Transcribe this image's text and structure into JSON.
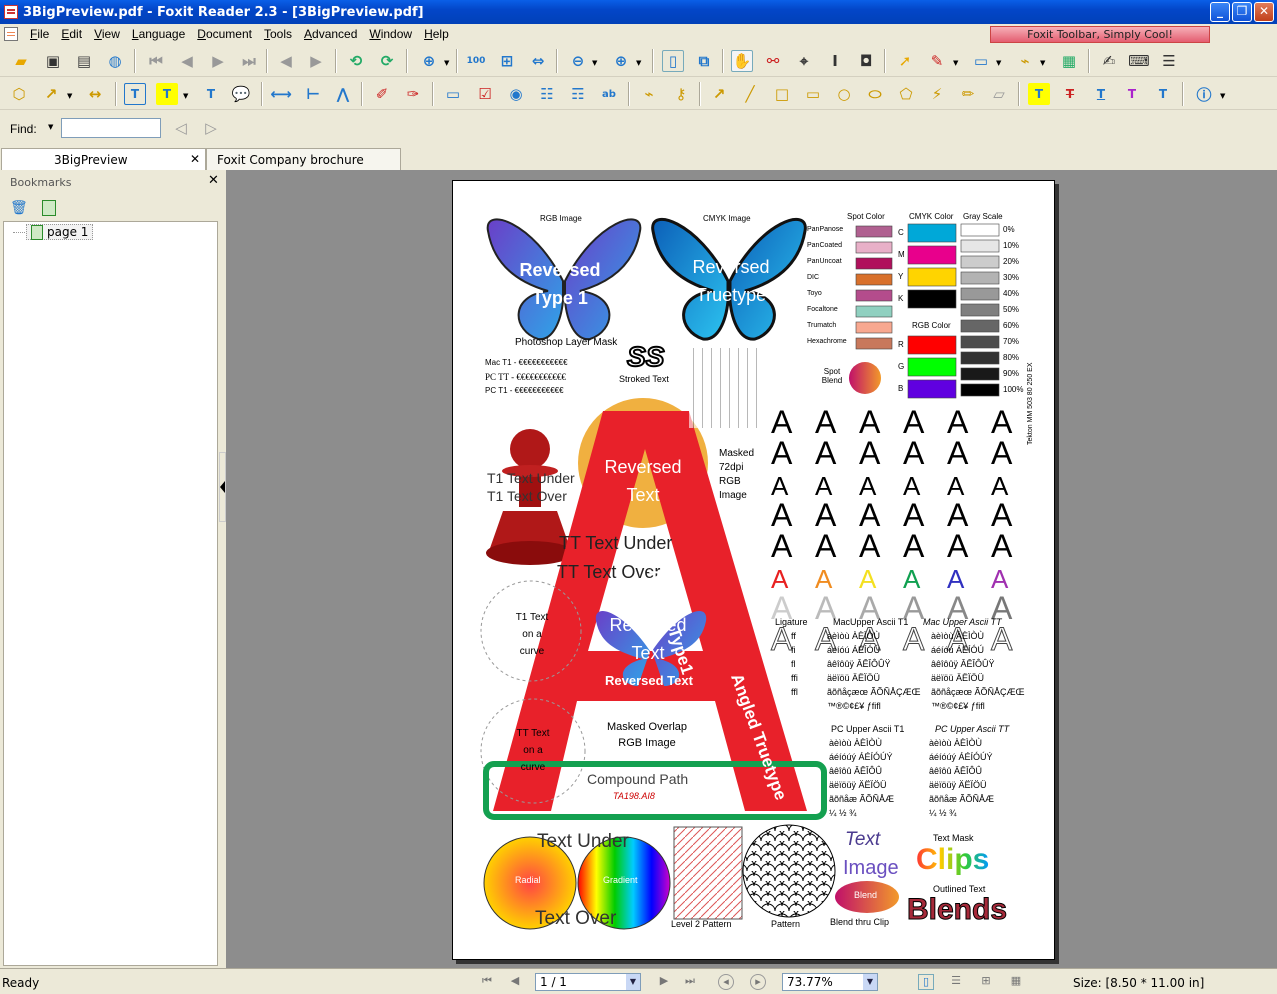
{
  "window": {
    "title": "3BigPreview.pdf - Foxit Reader 2.3 - [3BigPreview.pdf]"
  },
  "menu": [
    "File",
    "Edit",
    "View",
    "Language",
    "Document",
    "Tools",
    "Advanced",
    "Window",
    "Help"
  ],
  "promo": "Foxit Toolbar, Simply Cool!",
  "find": {
    "label": "Find:",
    "value": ""
  },
  "tabs": [
    {
      "label": "3BigPreview"
    },
    {
      "label": "Foxit Company brochure"
    }
  ],
  "sidebar": {
    "title": "Bookmarks",
    "bookmark": "page 1"
  },
  "status": {
    "ready": "Ready",
    "page": "1 / 1",
    "zoom": "73.77%",
    "size": "Size: [8.50 * 11.00 in]"
  },
  "pdf": {
    "rgb_image": "RGB Image",
    "cmyk_image": "CMYK Image",
    "rev_type1": "Reversed Type 1",
    "rev_truetype": "Reversed Truetype",
    "ps_mask": "Photoshop Layer Mask",
    "spot_color": "Spot Color",
    "cmyk_color": "CMYK Color",
    "gray_scale": "Gray Scale",
    "rgb_color": "RGB Color",
    "spot_names": [
      "PanPanose",
      "PanCoated",
      "PanUncoat",
      "DIC",
      "Toyo",
      "Focaltone",
      "Trumatch",
      "Hexachrome"
    ],
    "spot_colors": [
      "#b06090",
      "#e8b0c8",
      "#b0105c",
      "#d8702c",
      "#b44c8c",
      "#90d0c0",
      "#f8a890",
      "#c8785c"
    ],
    "cmyk_labels": [
      "C",
      "M",
      "Y",
      "K"
    ],
    "cmyk_colors": [
      "#00a8d8",
      "#e8008c",
      "#ffd400",
      "#000000"
    ],
    "rgb_labels": [
      "R",
      "G",
      "B"
    ],
    "rgb_colors": [
      "#ff0000",
      "#00ff00",
      "#6000e0"
    ],
    "gray_labels": [
      "0%",
      "10%",
      "20%",
      "30%",
      "40%",
      "50%",
      "60%",
      "70%",
      "80%",
      "90%",
      "100%"
    ],
    "spot_blend": "Spot Blend",
    "ss": "SS",
    "stroked_text": "Stroked Text",
    "mac_t1": "Mac T1 - €€€€€€€€€€€",
    "pc_tt": "PC TT - €€€€€€€€€€€",
    "pc_t1": "PC T1 - €€€€€€€€€€€",
    "t1_under": "T1 Text Under",
    "t1_over": "T1 Text Over",
    "masked_rgb": "Masked 72dpi RGB Image",
    "reversed_text": "Reversed Text",
    "tt_under": "TT Text Under",
    "tt_over": "TT Text Over",
    "t1_curve": "T1 Text on a curve",
    "tt_curve": "TT Text on a curve",
    "angled_type1": "Angled Type1",
    "angled_tt": "Angled Truetype",
    "masked_overlap": "Masked Overlap RGB Image",
    "compound_path": "Compound Path",
    "ta198": "TA198.AI8",
    "mm_label": "Tekton MM 503 80 250 EX",
    "ligature": "Ligature",
    "mac_upper_t1": "MacUpper Ascii T1",
    "mac_upper_tt": "Mac Upper Ascii TT",
    "pc_upper_t1": "PC Upper Ascii T1",
    "pc_upper_tt": "PC Upper Ascii TT",
    "lig_rows": [
      "ff",
      "fi",
      "fl",
      "ffi",
      "ffl"
    ],
    "mac_rows": [
      "àèìòù ÀÈÌÒÙ",
      "áéíóú ÁÉÍÓÚ",
      "âêîôûÿ ÂÊÎÔÛŸ",
      "äëïöü ÄËÏÖÜ",
      "ãõñåçæœ ÃÕÑÅÇÆŒ",
      "™®©¢£¥ ƒfifl"
    ],
    "pc_rows": [
      "àèìòù ÀÈÌÒÙ",
      "áéíóúý ÁÉÍÓÚÝ",
      "âêîôû ÂÊÎÔÛ",
      "äëïöüÿ ÄËÏÖÜ",
      "ãõñåæ ÃÕÑÅÆ",
      "¼ ½ ¾"
    ],
    "radial": "Radial",
    "gradient": "Gradient",
    "text_under": "Text Under",
    "text_over": "Text Over",
    "level2": "Level 2 Pattern",
    "pattern": "Pattern",
    "text": "Text",
    "image": "Image",
    "blend": "Blend",
    "blend_clip": "Blend thru Clip",
    "text_mask": "Text Mask",
    "clips": "Clips",
    "outlined": "Outlined Text",
    "blends": "Blends"
  }
}
